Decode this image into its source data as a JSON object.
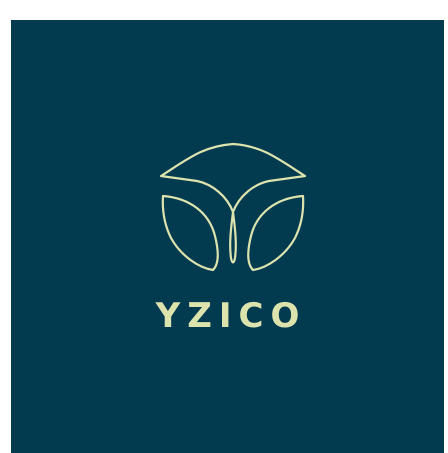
{
  "logo": {
    "wordmark": "YZICO",
    "background_color": "#023a50",
    "mark_color": "#dde3ad",
    "mark_icon": "leaf-lotus-icon"
  }
}
